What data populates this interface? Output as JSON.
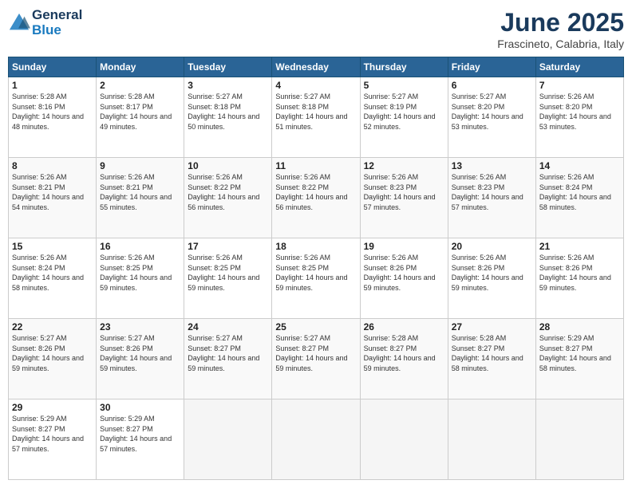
{
  "header": {
    "logo_line1": "General",
    "logo_line2": "Blue",
    "month": "June 2025",
    "location": "Frascineto, Calabria, Italy"
  },
  "weekdays": [
    "Sunday",
    "Monday",
    "Tuesday",
    "Wednesday",
    "Thursday",
    "Friday",
    "Saturday"
  ],
  "weeks": [
    [
      {
        "day": "1",
        "rise": "5:28 AM",
        "set": "8:16 PM",
        "daylight": "14 hours and 48 minutes."
      },
      {
        "day": "2",
        "rise": "5:28 AM",
        "set": "8:17 PM",
        "daylight": "14 hours and 49 minutes."
      },
      {
        "day": "3",
        "rise": "5:27 AM",
        "set": "8:18 PM",
        "daylight": "14 hours and 50 minutes."
      },
      {
        "day": "4",
        "rise": "5:27 AM",
        "set": "8:18 PM",
        "daylight": "14 hours and 51 minutes."
      },
      {
        "day": "5",
        "rise": "5:27 AM",
        "set": "8:19 PM",
        "daylight": "14 hours and 52 minutes."
      },
      {
        "day": "6",
        "rise": "5:27 AM",
        "set": "8:20 PM",
        "daylight": "14 hours and 53 minutes."
      },
      {
        "day": "7",
        "rise": "5:26 AM",
        "set": "8:20 PM",
        "daylight": "14 hours and 53 minutes."
      }
    ],
    [
      {
        "day": "8",
        "rise": "5:26 AM",
        "set": "8:21 PM",
        "daylight": "14 hours and 54 minutes."
      },
      {
        "day": "9",
        "rise": "5:26 AM",
        "set": "8:21 PM",
        "daylight": "14 hours and 55 minutes."
      },
      {
        "day": "10",
        "rise": "5:26 AM",
        "set": "8:22 PM",
        "daylight": "14 hours and 56 minutes."
      },
      {
        "day": "11",
        "rise": "5:26 AM",
        "set": "8:22 PM",
        "daylight": "14 hours and 56 minutes."
      },
      {
        "day": "12",
        "rise": "5:26 AM",
        "set": "8:23 PM",
        "daylight": "14 hours and 57 minutes."
      },
      {
        "day": "13",
        "rise": "5:26 AM",
        "set": "8:23 PM",
        "daylight": "14 hours and 57 minutes."
      },
      {
        "day": "14",
        "rise": "5:26 AM",
        "set": "8:24 PM",
        "daylight": "14 hours and 58 minutes."
      }
    ],
    [
      {
        "day": "15",
        "rise": "5:26 AM",
        "set": "8:24 PM",
        "daylight": "14 hours and 58 minutes."
      },
      {
        "day": "16",
        "rise": "5:26 AM",
        "set": "8:25 PM",
        "daylight": "14 hours and 59 minutes."
      },
      {
        "day": "17",
        "rise": "5:26 AM",
        "set": "8:25 PM",
        "daylight": "14 hours and 59 minutes."
      },
      {
        "day": "18",
        "rise": "5:26 AM",
        "set": "8:25 PM",
        "daylight": "14 hours and 59 minutes."
      },
      {
        "day": "19",
        "rise": "5:26 AM",
        "set": "8:26 PM",
        "daylight": "14 hours and 59 minutes."
      },
      {
        "day": "20",
        "rise": "5:26 AM",
        "set": "8:26 PM",
        "daylight": "14 hours and 59 minutes."
      },
      {
        "day": "21",
        "rise": "5:26 AM",
        "set": "8:26 PM",
        "daylight": "14 hours and 59 minutes."
      }
    ],
    [
      {
        "day": "22",
        "rise": "5:27 AM",
        "set": "8:26 PM",
        "daylight": "14 hours and 59 minutes."
      },
      {
        "day": "23",
        "rise": "5:27 AM",
        "set": "8:26 PM",
        "daylight": "14 hours and 59 minutes."
      },
      {
        "day": "24",
        "rise": "5:27 AM",
        "set": "8:27 PM",
        "daylight": "14 hours and 59 minutes."
      },
      {
        "day": "25",
        "rise": "5:27 AM",
        "set": "8:27 PM",
        "daylight": "14 hours and 59 minutes."
      },
      {
        "day": "26",
        "rise": "5:28 AM",
        "set": "8:27 PM",
        "daylight": "14 hours and 59 minutes."
      },
      {
        "day": "27",
        "rise": "5:28 AM",
        "set": "8:27 PM",
        "daylight": "14 hours and 58 minutes."
      },
      {
        "day": "28",
        "rise": "5:29 AM",
        "set": "8:27 PM",
        "daylight": "14 hours and 58 minutes."
      }
    ],
    [
      {
        "day": "29",
        "rise": "5:29 AM",
        "set": "8:27 PM",
        "daylight": "14 hours and 57 minutes."
      },
      {
        "day": "30",
        "rise": "5:29 AM",
        "set": "8:27 PM",
        "daylight": "14 hours and 57 minutes."
      },
      null,
      null,
      null,
      null,
      null
    ]
  ]
}
